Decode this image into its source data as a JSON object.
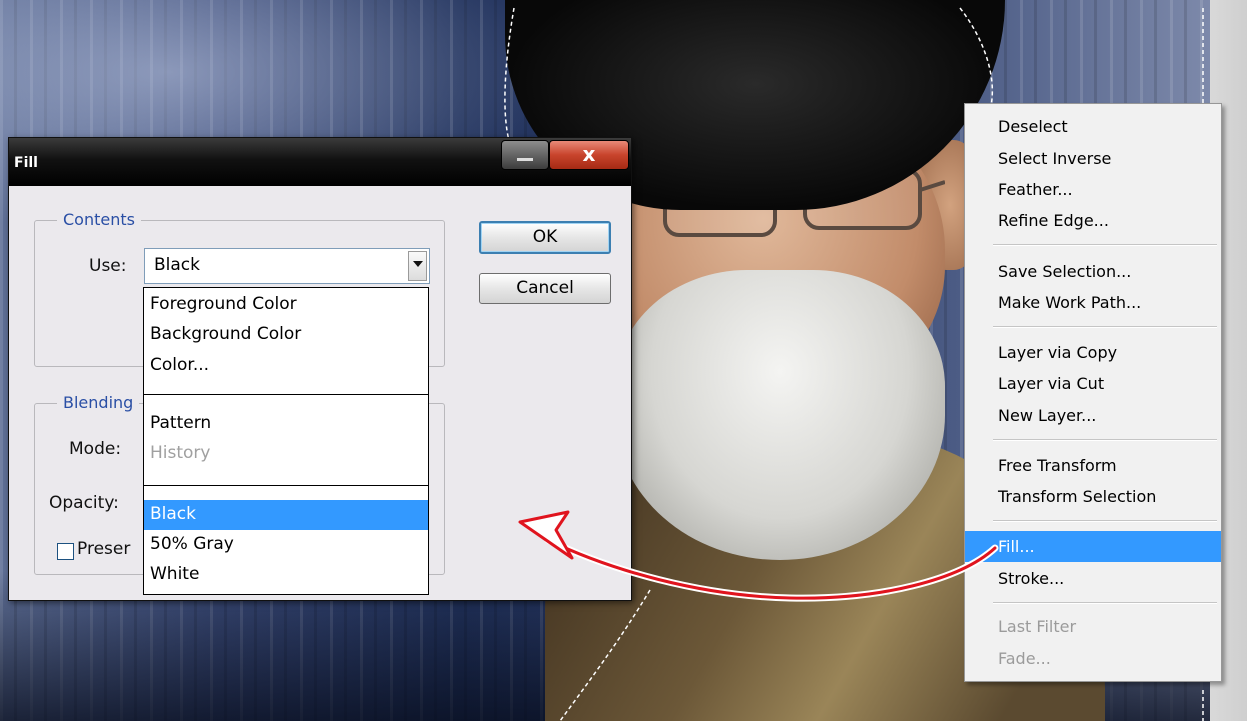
{
  "dialog": {
    "title": "Fill",
    "close_glyph": "x",
    "contents_legend": "Contents",
    "use_label": "Use:",
    "use_value": "Black",
    "blending_legend": "Blending",
    "mode_label": "Mode:",
    "opacity_label": "Opacity:",
    "preserve_label": "Preser",
    "ok_label": "OK",
    "cancel_label": "Cancel"
  },
  "use_dropdown": {
    "options": [
      {
        "label": "Foreground Color",
        "enabled": true
      },
      {
        "label": "Background Color",
        "enabled": true
      },
      {
        "label": "Color...",
        "enabled": true
      },
      {
        "label": "Pattern",
        "enabled": true
      },
      {
        "label": "History",
        "enabled": false
      },
      {
        "label": "Black",
        "enabled": true,
        "selected": true
      },
      {
        "label": "50% Gray",
        "enabled": true
      },
      {
        "label": "White",
        "enabled": true
      }
    ]
  },
  "context_menu": {
    "items": [
      {
        "label": "Deselect",
        "enabled": true
      },
      {
        "label": "Select Inverse",
        "enabled": true
      },
      {
        "label": "Feather...",
        "enabled": true
      },
      {
        "label": "Refine Edge...",
        "enabled": true
      },
      {
        "label": "Save Selection...",
        "enabled": true
      },
      {
        "label": "Make Work Path...",
        "enabled": true
      },
      {
        "label": "Layer via Copy",
        "enabled": true
      },
      {
        "label": "Layer via Cut",
        "enabled": true
      },
      {
        "label": "New Layer...",
        "enabled": true
      },
      {
        "label": "Free Transform",
        "enabled": true
      },
      {
        "label": "Transform Selection",
        "enabled": true
      },
      {
        "label": "Fill...",
        "enabled": true,
        "highlighted": true
      },
      {
        "label": "Stroke...",
        "enabled": true
      },
      {
        "label": "Last Filter",
        "enabled": false
      },
      {
        "label": "Fade...",
        "enabled": false
      }
    ]
  },
  "colors": {
    "selection_highlight": "#3399ff",
    "annotation_arrow": "#e0141e",
    "group_legend": "#2a4fa5",
    "dialog_background": "#ebe9ed"
  },
  "icons": {
    "minimize": "minimize-icon",
    "close": "close-icon",
    "dropdown_arrow": "chevron-down-icon",
    "annotation": "curved-arrow-icon"
  }
}
